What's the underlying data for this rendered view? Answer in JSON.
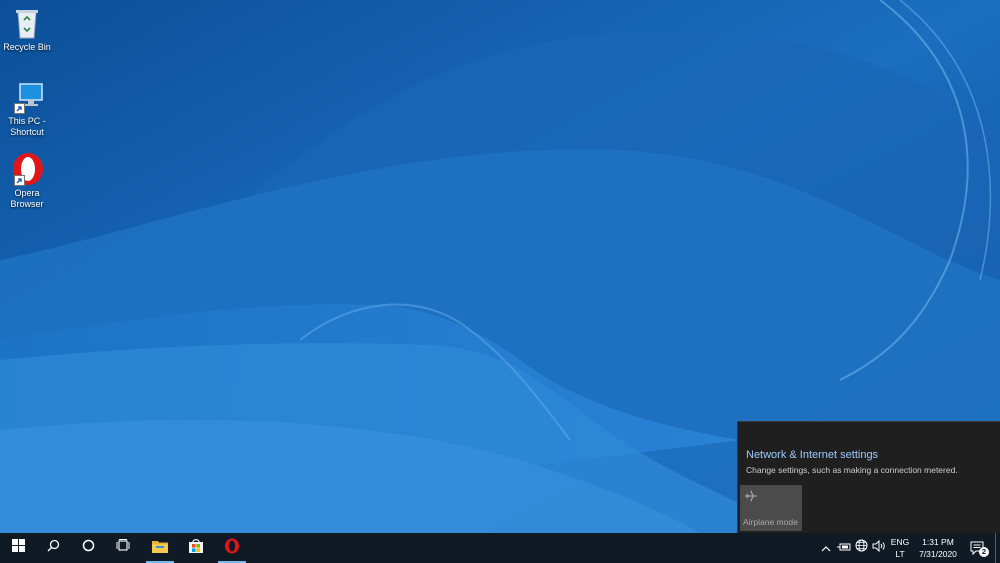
{
  "desktop": {
    "icons": [
      {
        "label_line1": "Recycle Bin",
        "label_line2": "",
        "icon": "recycle-bin-icon"
      },
      {
        "label_line1": "This PC -",
        "label_line2": "Shortcut",
        "icon": "computer-icon"
      },
      {
        "label_line1": "Opera",
        "label_line2": "Browser",
        "icon": "opera-icon"
      }
    ]
  },
  "flyout": {
    "title": "Network & Internet settings",
    "description": "Change settings, such as making a connection metered.",
    "tiles": [
      {
        "label": "Airplane mode",
        "icon": "airplane-icon"
      }
    ]
  },
  "taskbar": {
    "start": "windows-start-icon",
    "search": "search-icon",
    "cortana": "cortana-icon",
    "task_view": "task-view-icon",
    "pinned": [
      {
        "name": "File Explorer",
        "icon": "file-explorer-icon"
      },
      {
        "name": "Microsoft Store",
        "icon": "microsoft-store-icon"
      },
      {
        "name": "Opera",
        "icon": "opera-icon"
      }
    ],
    "tray": {
      "language_line1": "ENG",
      "language_line2": "LT",
      "time": "1:31 PM",
      "date": "7/31/2020",
      "notification_count": "2"
    }
  },
  "colors": {
    "link": "#9ecbff",
    "taskbar": "#101a24",
    "flyout": "#1f1f1f",
    "accent": "#76b9ed"
  }
}
